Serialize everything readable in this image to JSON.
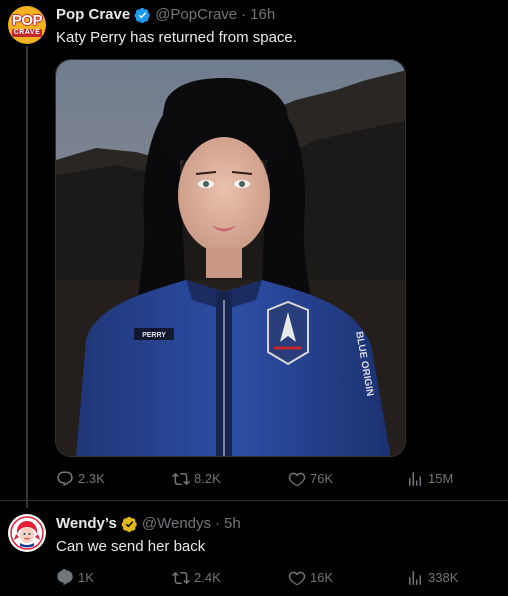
{
  "tweets": [
    {
      "author": {
        "name": "Pop Crave",
        "handle": "@PopCrave",
        "time": "16h",
        "verified": "blue",
        "avatar_top": "POP",
        "avatar_bottom": "CRAVE"
      },
      "text": "Katy Perry has returned from space.",
      "media": {
        "suit_name_tag": "PERRY",
        "sleeve_text": "BLUE ORIGIN"
      },
      "stats": {
        "replies": "2.3K",
        "retweets": "8.2K",
        "likes": "76K",
        "views": "15M"
      }
    },
    {
      "author": {
        "name": "Wendy’s",
        "handle": "@Wendys",
        "time": "5h",
        "verified": "gold"
      },
      "text": "Can we send her back",
      "stats": {
        "replies": "1K",
        "retweets": "2.4K",
        "likes": "16K",
        "views": "338K"
      }
    }
  ],
  "separator": "·",
  "colors": {
    "background": "#000000",
    "text": "#e7e9ea",
    "muted": "#71767b",
    "verified_blue": "#1d9bf0",
    "verified_gold": "#e2b719",
    "border": "#2f3336"
  },
  "icons": [
    "reply-icon",
    "retweet-icon",
    "like-icon",
    "views-icon",
    "verified-badge-icon"
  ]
}
